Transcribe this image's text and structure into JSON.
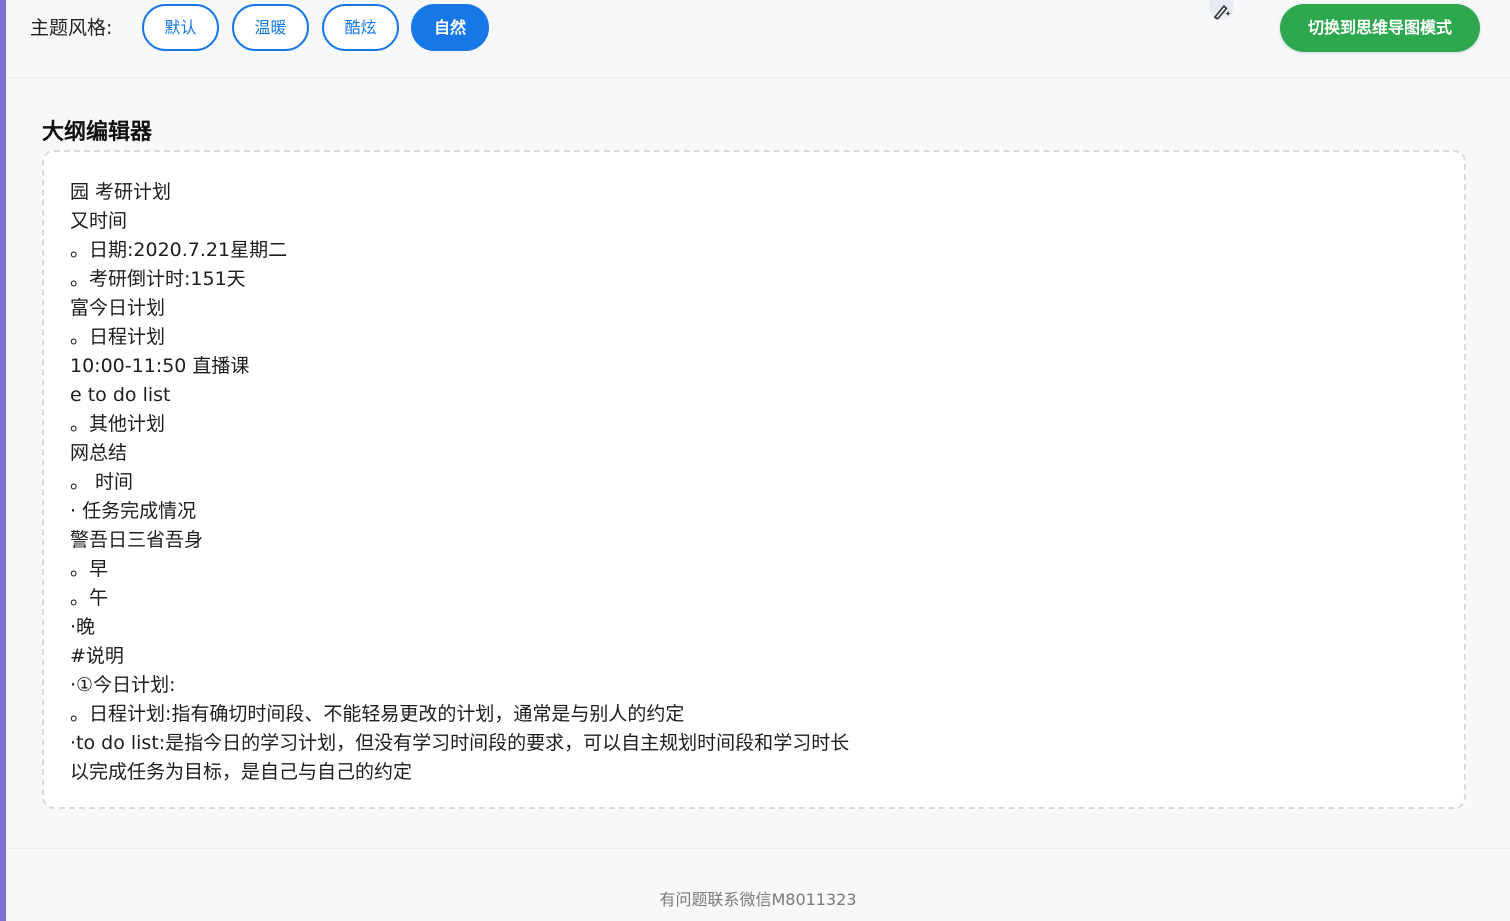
{
  "toolbar": {
    "theme_label": "主题风格:",
    "themes": [
      {
        "label": "默认",
        "active": false
      },
      {
        "label": "温暖",
        "active": false
      },
      {
        "label": "酷炫",
        "active": false
      },
      {
        "label": "自然",
        "active": true
      }
    ],
    "switch_label": "切换到思维导图模式",
    "pen_icon": "pen-sparkle-icon"
  },
  "editor": {
    "title": "大纲编辑器",
    "lines": [
      "园 考研计划",
      "又时间",
      "。日期:2020.7.21星期二",
      "。考研倒计时:151天",
      "富今日计划",
      "。日程计划",
      "10:00-11:50 直播课",
      "e to do list",
      "。其他计划",
      "网总结",
      "。 时间",
      "· 任务完成情况",
      "警吾日三省吾身",
      "。早",
      "。午",
      "·晚",
      "#说明",
      "·①今日计划:",
      "。日程计划:指有确切时间段、不能轻易更改的计划，通常是与别人的约定",
      "·to do list:是指今日的学习计划，但没有学习时间段的要求，可以自主规划时间段和学习时长",
      "以完成任务为目标，是自己与自己的约定"
    ]
  },
  "footer": {
    "text": "有问题联系微信M8011323"
  },
  "colors": {
    "primary": "#1677e6",
    "switch": "#2ea84f",
    "border_left": "#7b6fd0"
  }
}
